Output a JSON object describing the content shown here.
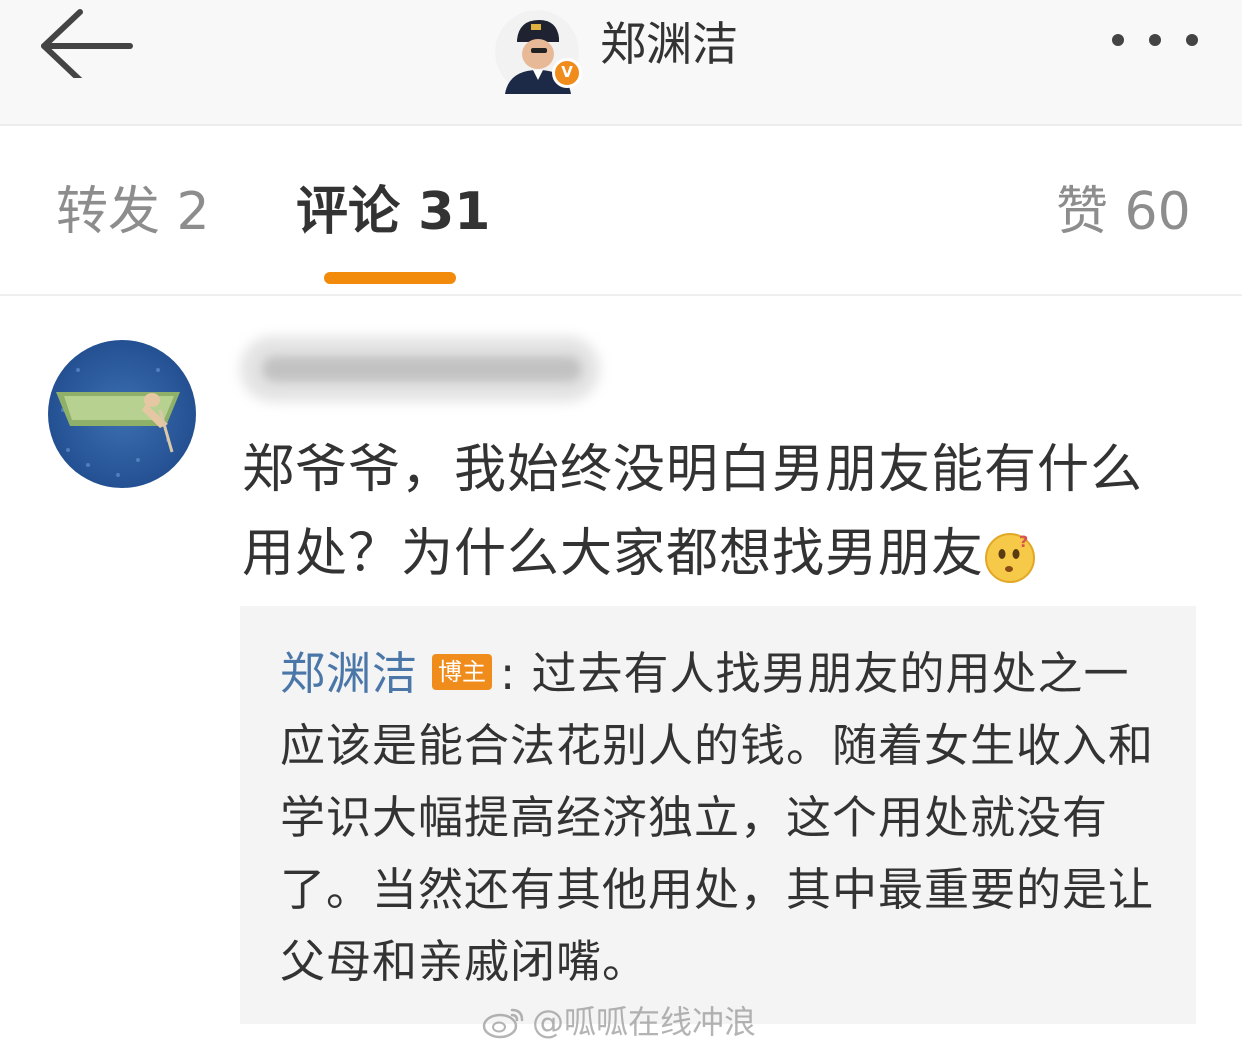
{
  "header": {
    "title": "郑渊洁",
    "verified_mark": "V"
  },
  "tabs": [
    {
      "label": "转发 2"
    },
    {
      "label": "评论 31"
    },
    {
      "label": "赞 60"
    }
  ],
  "accent_color": "#f28a0c",
  "link_color": "#4b77a8",
  "comment": {
    "text": "郑爷爷，我始终没明白男朋友能有什么用处？为什么大家都想找男朋友",
    "emoji_icon": "confused-face-icon"
  },
  "reply": {
    "author": "郑渊洁",
    "badge": "博主",
    "text": ": 过去有人找男朋友的用处之一应该是能合法花别人的钱。随着女生收入和学识大幅提高经济独立，这个用处就没有了。当然还有其他用处，其中最重要的是让父母和亲戚闭嘴。"
  },
  "watermark": {
    "text": "@呱呱在线冲浪"
  }
}
